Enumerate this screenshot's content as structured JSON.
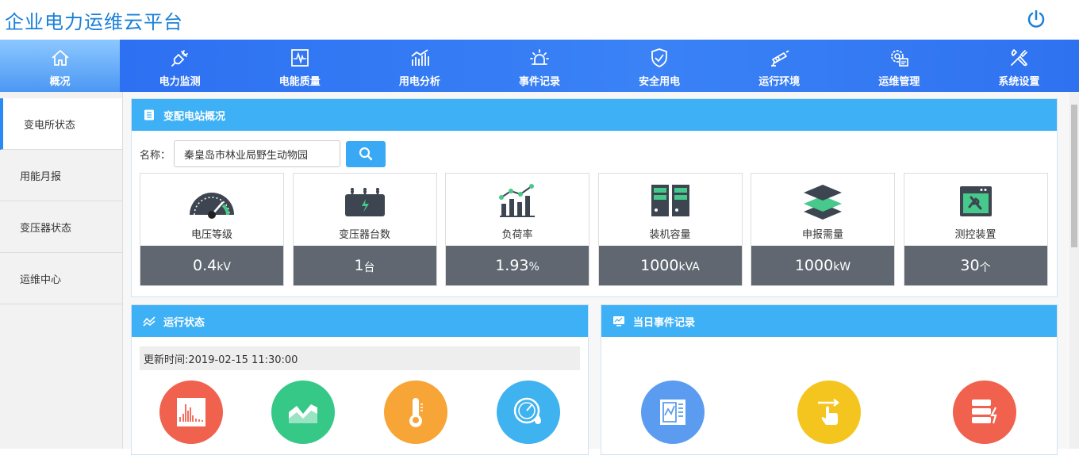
{
  "app": {
    "title": "企业电力运维云平台"
  },
  "nav": {
    "items": [
      {
        "label": "概况",
        "icon": "home-icon"
      },
      {
        "label": "电力监测",
        "icon": "plug-icon"
      },
      {
        "label": "电能质量",
        "icon": "waveform-icon"
      },
      {
        "label": "用电分析",
        "icon": "bar-chart-icon"
      },
      {
        "label": "事件记录",
        "icon": "alarm-light-icon"
      },
      {
        "label": "安全用电",
        "icon": "shield-check-icon"
      },
      {
        "label": "运行环境",
        "icon": "camera-icon"
      },
      {
        "label": "运维管理",
        "icon": "gear-calendar-icon"
      },
      {
        "label": "系统设置",
        "icon": "tools-icon"
      }
    ],
    "active_index": 0
  },
  "sidebar": {
    "items": [
      {
        "label": "变电所状态"
      },
      {
        "label": "用能月报"
      },
      {
        "label": "变压器状态"
      },
      {
        "label": "运维中心"
      }
    ],
    "active_index": 0
  },
  "overview": {
    "title": "变配电站概况",
    "search": {
      "label": "名称：",
      "value": "秦皇岛市林业局野生动物园"
    },
    "stats": [
      {
        "label": "电压等级",
        "value": "0.4",
        "unit": "kV",
        "icon": "gauge-icon"
      },
      {
        "label": "变压器台数",
        "value": "1",
        "unit": "台",
        "icon": "transformer-icon"
      },
      {
        "label": "负荷率",
        "value": "1.93",
        "unit": "%",
        "icon": "load-chart-icon"
      },
      {
        "label": "装机容量",
        "value": "1000",
        "unit": "kVA",
        "icon": "server-icon"
      },
      {
        "label": "申报需量",
        "value": "1000",
        "unit": "kW",
        "icon": "layers-icon"
      },
      {
        "label": "测控装置",
        "value": "30",
        "unit": "个",
        "icon": "device-icon"
      }
    ]
  },
  "running": {
    "title": "运行状态",
    "update_time": "更新时间:2019-02-15 11:30:00",
    "indicators": [
      {
        "icon": "spectrum-icon",
        "color": "#f0614e"
      },
      {
        "icon": "area-chart-icon",
        "color": "#35c887"
      },
      {
        "icon": "thermometer-icon",
        "color": "#f7a537"
      },
      {
        "icon": "pressure-gauge-icon",
        "color": "#3fb2f0"
      }
    ]
  },
  "events": {
    "title": "当日事件记录",
    "indicators": [
      {
        "icon": "report-icon",
        "color": "#5b9cf0"
      },
      {
        "icon": "touch-icon",
        "color": "#f5c51f"
      },
      {
        "icon": "server-alert-icon",
        "color": "#f0614e"
      }
    ]
  },
  "colors": {
    "primary": "#2a6cf0",
    "panel_header": "#3eb0f5",
    "stat_value_bg": "#606770"
  }
}
